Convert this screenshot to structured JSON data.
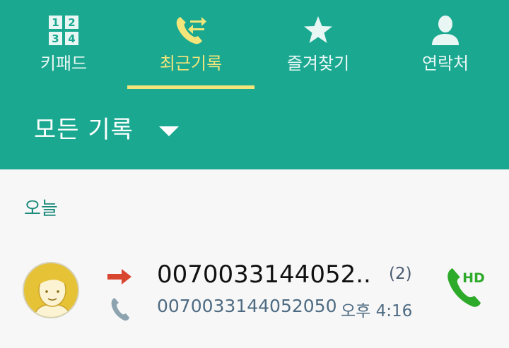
{
  "tabs": [
    {
      "label": "키패드",
      "icon": "keypad-icon",
      "active": false
    },
    {
      "label": "최근기록",
      "icon": "recent-calls-icon",
      "active": true
    },
    {
      "label": "즐겨찾기",
      "icon": "star-icon",
      "active": false
    },
    {
      "label": "연락처",
      "icon": "contact-person-icon",
      "active": false
    }
  ],
  "keypad_digits": [
    "1",
    "2",
    "3",
    "4"
  ],
  "filter": {
    "label": "모든 기록",
    "icon": "dropdown-arrow-icon"
  },
  "section": {
    "label": "오늘"
  },
  "log": [
    {
      "name": "0070033144052...",
      "count": "(2)",
      "number": "0070033144052050",
      "time": "오후 4:16",
      "direction": "outgoing",
      "call_type": "voice",
      "hd_label": "HD"
    }
  ],
  "colors": {
    "header": "#1aa891",
    "active_tab": "#f3e57a",
    "outgoing_arrow": "#d8462f",
    "hd_call": "#2eaa2a",
    "section_text": "#1c8b7b"
  }
}
